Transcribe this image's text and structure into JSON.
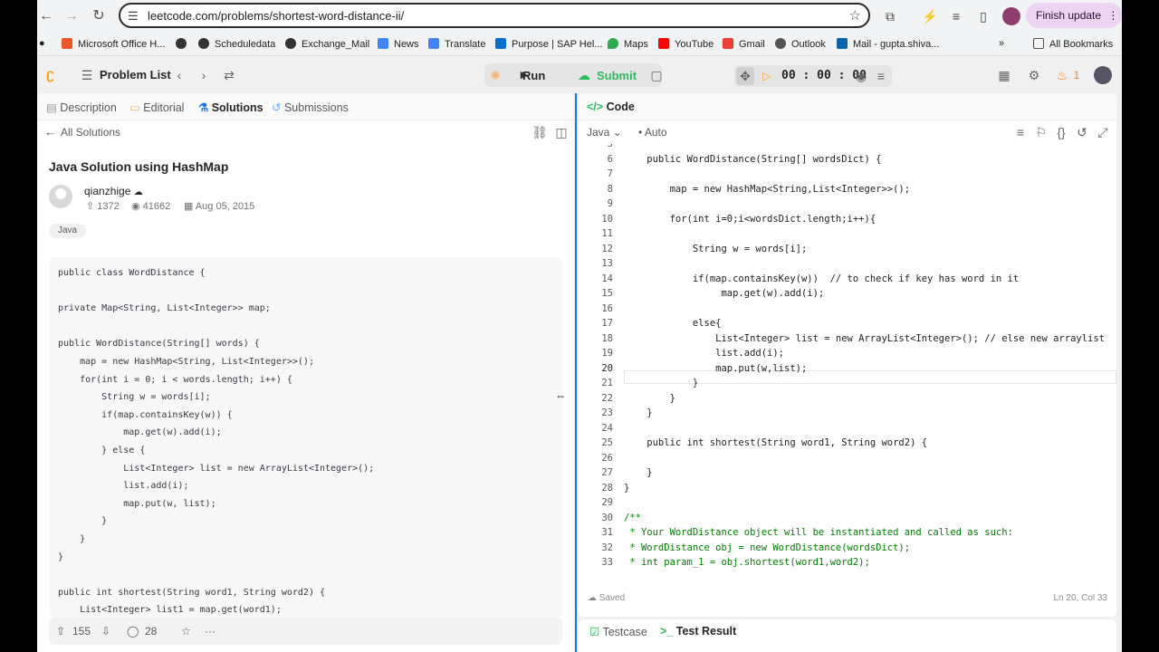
{
  "browser": {
    "url": "leetcode.com/problems/shortest-word-distance-ii/",
    "finish_update": "Finish update",
    "bookmarks": [
      {
        "label": "Microsoft Office H...",
        "color": "#e8582a"
      },
      {
        "label": "Scheduledata",
        "color": "#333333"
      },
      {
        "label": "Exchange_Mail",
        "color": "#333333"
      },
      {
        "label": "News",
        "color": "#4285f4"
      },
      {
        "label": "Translate",
        "color": "#4285f4"
      },
      {
        "label": "Purpose | SAP Hel...",
        "color": "#0a6ed1"
      },
      {
        "label": "Maps",
        "color": "#34a853"
      },
      {
        "label": "YouTube",
        "color": "#ff0000"
      },
      {
        "label": "Gmail",
        "color": "#ea4335"
      },
      {
        "label": "Outlook",
        "color": "#555555"
      },
      {
        "label": "Mail - gupta.shiva...",
        "color": "#0a64ad"
      }
    ],
    "all_bookmarks": "All Bookmarks"
  },
  "topbar": {
    "problem_list": "Problem List",
    "run": "Run",
    "submit": "Submit",
    "timer": "00 : 00 : 00",
    "streak": "1"
  },
  "left": {
    "tabs": [
      "Description",
      "Editorial",
      "Solutions",
      "Submissions"
    ],
    "all_solutions": "All Solutions",
    "title": "Java Solution using HashMap",
    "author": "qianzhige",
    "votes": "1372",
    "views": "41662",
    "date": "Aug 05, 2015",
    "tag": "Java",
    "code": [
      "public class WordDistance {",
      "",
      "private Map<String, List<Integer>> map;",
      "",
      "public WordDistance(String[] words) {",
      "    map = new HashMap<String, List<Integer>>();",
      "    for(int i = 0; i < words.length; i++) {",
      "        String w = words[i];",
      "        if(map.containsKey(w)) {",
      "            map.get(w).add(i);",
      "        } else {",
      "            List<Integer> list = new ArrayList<Integer>();",
      "            list.add(i);",
      "            map.put(w, list);",
      "        }",
      "    }",
      "}",
      "",
      "public int shortest(String word1, String word2) {",
      "    List<Integer> list1 = map.get(word1);"
    ],
    "upvotes": "155",
    "comments": "28"
  },
  "right": {
    "code_label": "Code",
    "language": "Java",
    "auto": "Auto",
    "lines": [
      {
        "n": "5",
        "t": ""
      },
      {
        "n": "6",
        "t": "    public WordDistance(String[] wordsDict) {"
      },
      {
        "n": "7",
        "t": ""
      },
      {
        "n": "8",
        "t": "        map = new HashMap<String,List<Integer>>();"
      },
      {
        "n": "9",
        "t": ""
      },
      {
        "n": "10",
        "t": "        for(int i=0;i<wordsDict.length;i++){"
      },
      {
        "n": "11",
        "t": ""
      },
      {
        "n": "12",
        "t": "            String w = words[i];"
      },
      {
        "n": "13",
        "t": ""
      },
      {
        "n": "14",
        "t": "            if(map.containsKey(w))  // to check if key has word in it"
      },
      {
        "n": "15",
        "t": "                 map.get(w).add(i);"
      },
      {
        "n": "16",
        "t": ""
      },
      {
        "n": "17",
        "t": "            else{"
      },
      {
        "n": "18",
        "t": "                List<Integer> list = new ArrayList<Integer>(); // else new arraylist"
      },
      {
        "n": "19",
        "t": "                list.add(i);"
      },
      {
        "n": "20",
        "t": "                map.put(w,list);"
      },
      {
        "n": "21",
        "t": "            }"
      },
      {
        "n": "22",
        "t": "        }"
      },
      {
        "n": "23",
        "t": "    }"
      },
      {
        "n": "24",
        "t": ""
      },
      {
        "n": "25",
        "t": "    public int shortest(String word1, String word2) {"
      },
      {
        "n": "26",
        "t": ""
      },
      {
        "n": "27",
        "t": "    }"
      },
      {
        "n": "28",
        "t": "}"
      },
      {
        "n": "29",
        "t": ""
      },
      {
        "n": "30",
        "t": "/**"
      },
      {
        "n": "31",
        "t": " * Your WordDistance object will be instantiated and called as such:"
      },
      {
        "n": "32",
        "t": " * WordDistance obj = new WordDistance(wordsDict);"
      },
      {
        "n": "33",
        "t": " * int param_1 = obj.shortest(word1,word2);"
      }
    ],
    "saved": "Saved",
    "cursor_pos": "Ln 20, Col 33",
    "bottom_tabs": [
      "Testcase",
      "Test Result"
    ]
  }
}
